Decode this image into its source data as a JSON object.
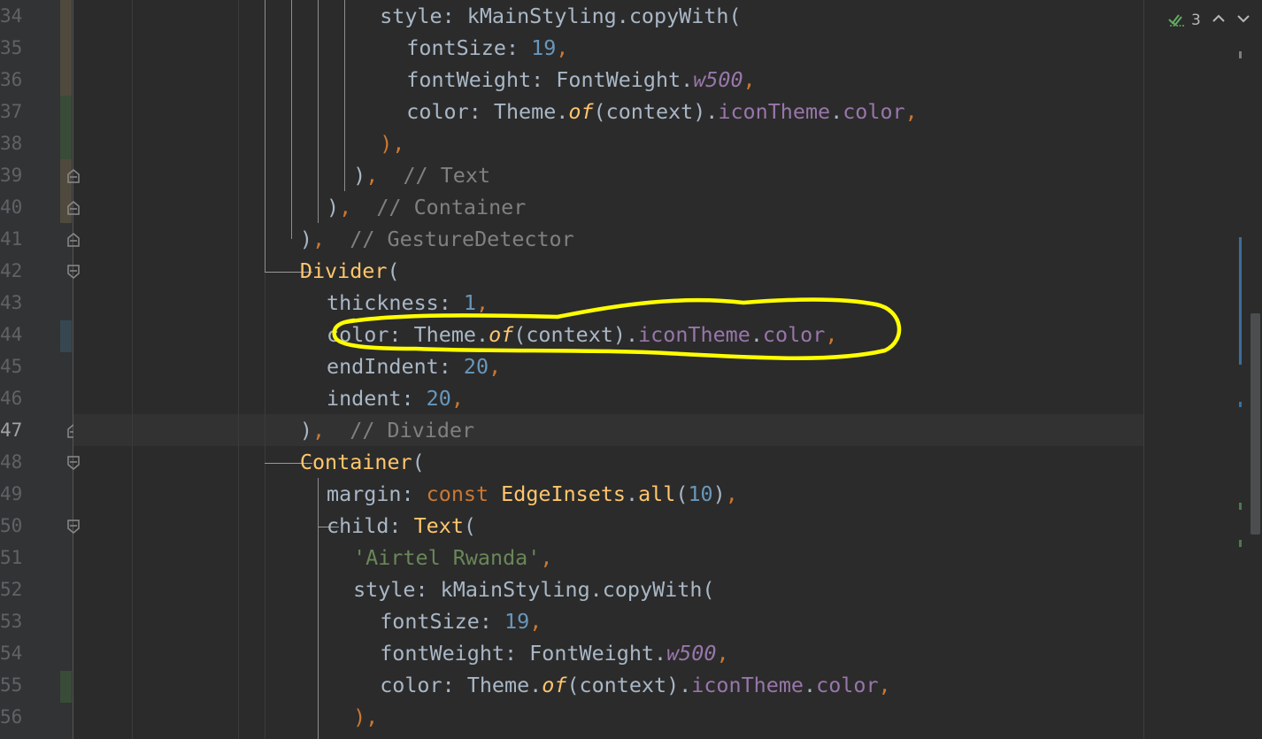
{
  "line_numbers": [
    "34",
    "35",
    "36",
    "37",
    "38",
    "39",
    "40",
    "41",
    "42",
    "43",
    "44",
    "45",
    "46",
    "47",
    "48",
    "49",
    "50",
    "51",
    "52",
    "53",
    "54",
    "55",
    "56"
  ],
  "current_line_index": 13,
  "inspection": {
    "count": "3",
    "icon": "check-double-icon"
  },
  "code": [
    {
      "indent": 12,
      "tokens": [
        {
          "t": "style: kMainStyling.copyWith(",
          "k": "plain"
        }
      ]
    },
    {
      "indent": 13,
      "tokens": [
        {
          "t": "fontSize: ",
          "k": "plain"
        },
        {
          "t": "19",
          "k": "num"
        },
        {
          "t": ",",
          "k": "punc"
        }
      ]
    },
    {
      "indent": 13,
      "tokens": [
        {
          "t": "fontWeight: FontWeight.",
          "k": "plain"
        },
        {
          "t": "w500",
          "k": "italic"
        },
        {
          "t": ",",
          "k": "punc"
        }
      ]
    },
    {
      "indent": 13,
      "tokens": [
        {
          "t": "color: Theme.",
          "k": "plain"
        },
        {
          "t": "of",
          "k": "method"
        },
        {
          "t": "(context).",
          "k": "plain"
        },
        {
          "t": "iconTheme",
          "k": "prop"
        },
        {
          "t": ".",
          "k": "plain"
        },
        {
          "t": "color",
          "k": "prop"
        },
        {
          "t": ",",
          "k": "punc"
        }
      ]
    },
    {
      "indent": 12,
      "tokens": [
        {
          "t": "),",
          "k": "punc"
        }
      ]
    },
    {
      "indent": 11,
      "tokens": [
        {
          "t": ")",
          "k": "plain"
        },
        {
          "t": ",",
          "k": "punc"
        },
        {
          "t": "  // Text",
          "k": "comment"
        }
      ]
    },
    {
      "indent": 10,
      "tokens": [
        {
          "t": ")",
          "k": "plain"
        },
        {
          "t": ",",
          "k": "punc"
        },
        {
          "t": "  // Container",
          "k": "comment"
        }
      ]
    },
    {
      "indent": 9,
      "tokens": [
        {
          "t": ")",
          "k": "plain"
        },
        {
          "t": ",",
          "k": "punc"
        },
        {
          "t": "  // GestureDetector",
          "k": "comment"
        }
      ]
    },
    {
      "indent": 9,
      "tokens": [
        {
          "t": "Divider",
          "k": "cls"
        },
        {
          "t": "(",
          "k": "plain"
        }
      ]
    },
    {
      "indent": 10,
      "tokens": [
        {
          "t": "thickness: ",
          "k": "plain"
        },
        {
          "t": "1",
          "k": "num"
        },
        {
          "t": ",",
          "k": "punc"
        }
      ]
    },
    {
      "indent": 10,
      "tokens": [
        {
          "t": "color: Theme.",
          "k": "plain"
        },
        {
          "t": "of",
          "k": "method"
        },
        {
          "t": "(context).",
          "k": "plain"
        },
        {
          "t": "iconTheme",
          "k": "prop"
        },
        {
          "t": ".",
          "k": "plain"
        },
        {
          "t": "color",
          "k": "prop"
        },
        {
          "t": ",",
          "k": "punc"
        }
      ]
    },
    {
      "indent": 10,
      "tokens": [
        {
          "t": "endIndent: ",
          "k": "plain"
        },
        {
          "t": "20",
          "k": "num"
        },
        {
          "t": ",",
          "k": "punc"
        }
      ]
    },
    {
      "indent": 10,
      "tokens": [
        {
          "t": "indent: ",
          "k": "plain"
        },
        {
          "t": "20",
          "k": "num"
        },
        {
          "t": ",",
          "k": "punc"
        }
      ]
    },
    {
      "indent": 9,
      "tokens": [
        {
          "t": ")",
          "k": "plain"
        },
        {
          "t": ",",
          "k": "punc"
        },
        {
          "t": "  // Divider",
          "k": "comment"
        }
      ]
    },
    {
      "indent": 9,
      "tokens": [
        {
          "t": "Container",
          "k": "cls"
        },
        {
          "t": "(",
          "k": "plain"
        }
      ]
    },
    {
      "indent": 10,
      "tokens": [
        {
          "t": "margin: ",
          "k": "plain"
        },
        {
          "t": "const ",
          "k": "kw"
        },
        {
          "t": "EdgeInsets",
          "k": "cls"
        },
        {
          "t": ".",
          "k": "plain"
        },
        {
          "t": "all",
          "k": "cls"
        },
        {
          "t": "(",
          "k": "plain"
        },
        {
          "t": "10",
          "k": "num"
        },
        {
          "t": ")",
          "k": "plain"
        },
        {
          "t": ",",
          "k": "punc"
        }
      ]
    },
    {
      "indent": 10,
      "tokens": [
        {
          "t": "child: ",
          "k": "plain"
        },
        {
          "t": "Text",
          "k": "cls"
        },
        {
          "t": "(",
          "k": "plain"
        }
      ]
    },
    {
      "indent": 11,
      "tokens": [
        {
          "t": "'Airtel Rwanda'",
          "k": "str"
        },
        {
          "t": ",",
          "k": "punc"
        }
      ]
    },
    {
      "indent": 11,
      "tokens": [
        {
          "t": "style: kMainStyling.copyWith(",
          "k": "plain"
        }
      ]
    },
    {
      "indent": 12,
      "tokens": [
        {
          "t": "fontSize: ",
          "k": "plain"
        },
        {
          "t": "19",
          "k": "num"
        },
        {
          "t": ",",
          "k": "punc"
        }
      ]
    },
    {
      "indent": 12,
      "tokens": [
        {
          "t": "fontWeight: FontWeight.",
          "k": "plain"
        },
        {
          "t": "w500",
          "k": "italic"
        },
        {
          "t": ",",
          "k": "punc"
        }
      ]
    },
    {
      "indent": 12,
      "tokens": [
        {
          "t": "color: Theme.",
          "k": "plain"
        },
        {
          "t": "of",
          "k": "method"
        },
        {
          "t": "(context).",
          "k": "plain"
        },
        {
          "t": "iconTheme",
          "k": "prop"
        },
        {
          "t": ".",
          "k": "plain"
        },
        {
          "t": "color",
          "k": "prop"
        },
        {
          "t": ",",
          "k": "punc"
        }
      ]
    },
    {
      "indent": 11,
      "tokens": [
        {
          "t": "),",
          "k": "punc"
        }
      ]
    }
  ],
  "colors": {
    "background": "#2b2b2b",
    "gutter": "#313335",
    "added": "#384c38",
    "modified": "#4f4a3d",
    "changed_blue": "#374752",
    "annotation": "#ffff00",
    "bulb": "#f0c03a"
  }
}
